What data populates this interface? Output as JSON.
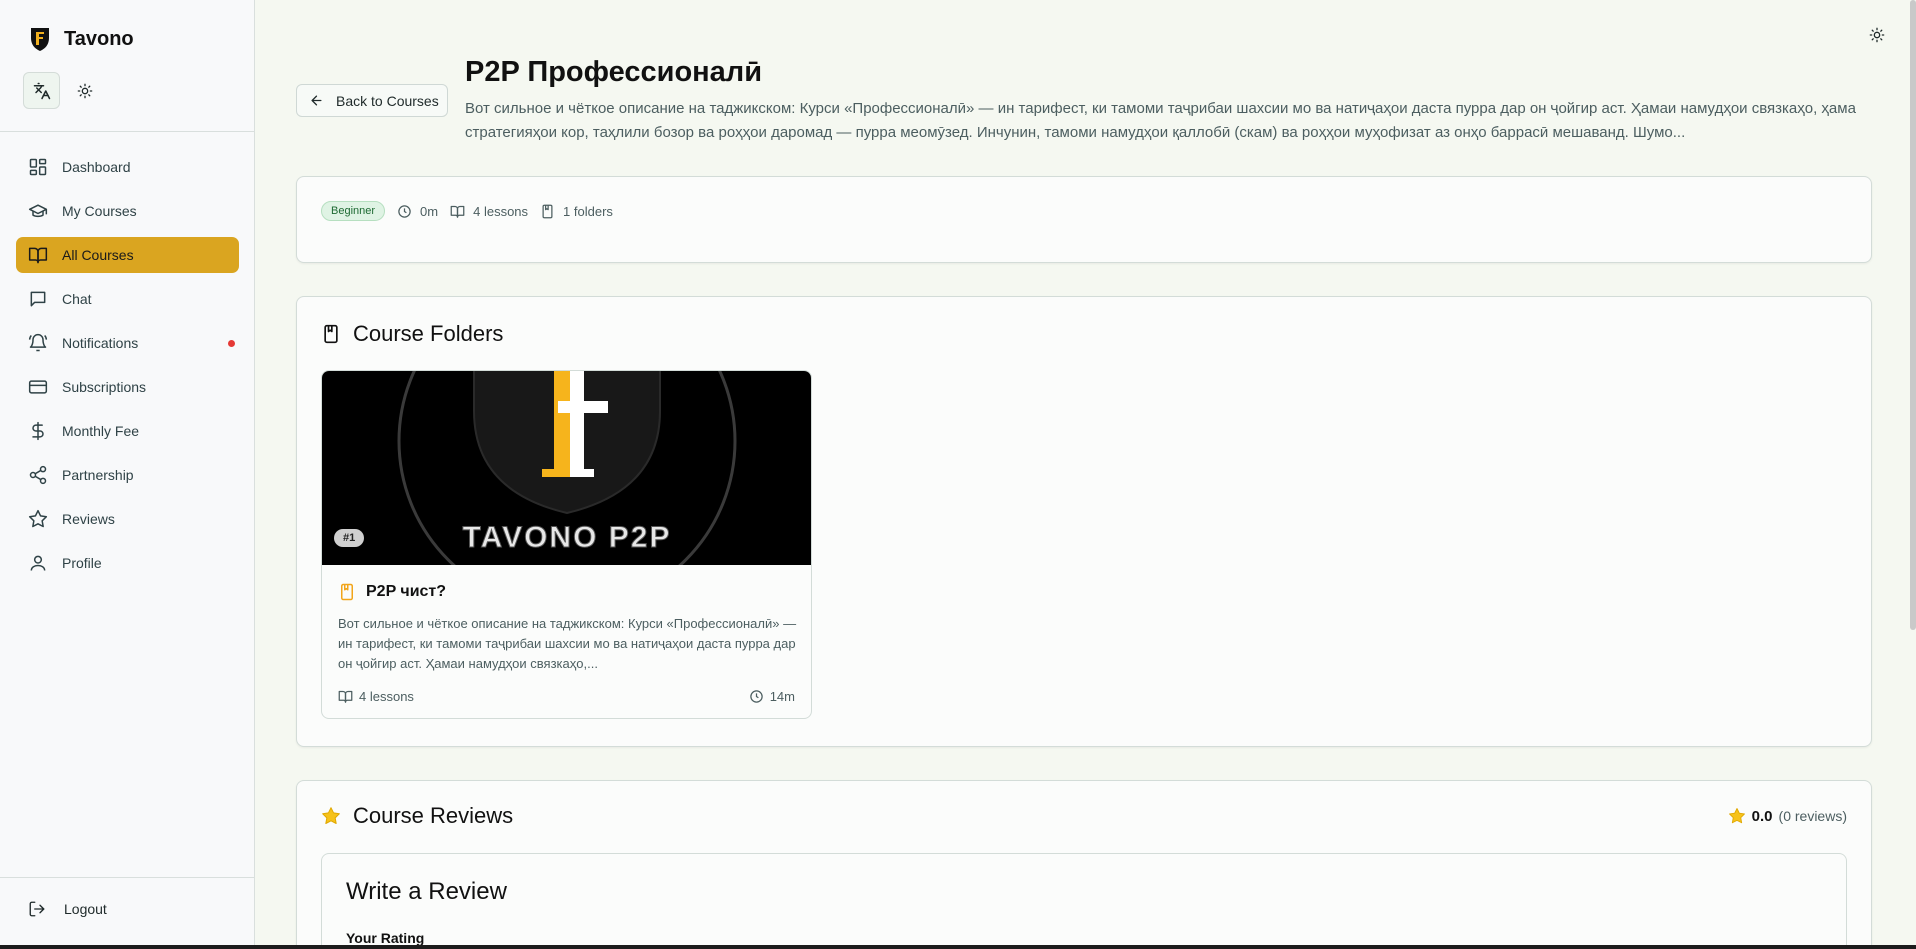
{
  "brand": {
    "name": "Tavono",
    "logo_text": "TAVONO P2P"
  },
  "toolbar": {
    "language_icon": "translate-icon",
    "theme_icon": "sun-icon"
  },
  "sidebar": {
    "items": [
      {
        "label": "Dashboard",
        "icon": "dashboard-icon",
        "active": false
      },
      {
        "label": "My Courses",
        "icon": "graduation-cap-icon",
        "active": false
      },
      {
        "label": "All Courses",
        "icon": "book-open-icon",
        "active": true
      },
      {
        "label": "Chat",
        "icon": "chat-icon",
        "active": false
      },
      {
        "label": "Notifications",
        "icon": "bell-icon",
        "active": false,
        "has_dot": true
      },
      {
        "label": "Subscriptions",
        "icon": "credit-card-icon",
        "active": false
      },
      {
        "label": "Monthly Fee",
        "icon": "dollar-icon",
        "active": false
      },
      {
        "label": "Partnership",
        "icon": "share-icon",
        "active": false
      },
      {
        "label": "Reviews",
        "icon": "star-icon",
        "active": false
      },
      {
        "label": "Profile",
        "icon": "user-icon",
        "active": false
      }
    ],
    "logout_label": "Logout",
    "active_color": "#daa520",
    "notification_dot_color": "#e53935"
  },
  "header": {
    "back_label": "Back to Courses",
    "title": "P2P Профессионалӣ",
    "description": "Вот сильное и чёткое описание на таджикском: Курси «Профессионалӣ» — ин тарифест, ки тамоми таҷрибаи шахсии мо ва натиҷаҳои даста пурра дар он ҷойгир аст. Ҳамаи намудҳои связкаҳо, ҳама стратегияҳои кор, таҳлили бозор ва роҳҳои даромад — пурра меомӯзед. Инчунин, тамоми намудҳои қаллобӣ (скам) ва роҳҳои муҳофизат аз онҳо баррасӣ мешаванд. Шумо..."
  },
  "meta": {
    "level": "Beginner",
    "duration": "0m",
    "lessons": "4 lessons",
    "folders": "1 folders"
  },
  "folders_section": {
    "title": "Course Folders",
    "folders": [
      {
        "number": "#1",
        "title": "P2P чист?",
        "description": "Вот сильное и чёткое описание на таджикском: Курси «Профессионалӣ» — ин тарифест, ки тамоми таҷрибаи шахсии мо ва натиҷаҳои даста пурра дар он ҷойгир аст. Ҳамаи намудҳои связкаҳо,...",
        "lessons": "4 lessons",
        "duration": "14m",
        "image_letter": "F",
        "image_text": "TAVONO P2P"
      }
    ]
  },
  "reviews_section": {
    "title": "Course Reviews",
    "rating": "0.0",
    "review_count": "(0 reviews)",
    "write_title": "Write a Review",
    "your_rating_label": "Your Rating"
  }
}
